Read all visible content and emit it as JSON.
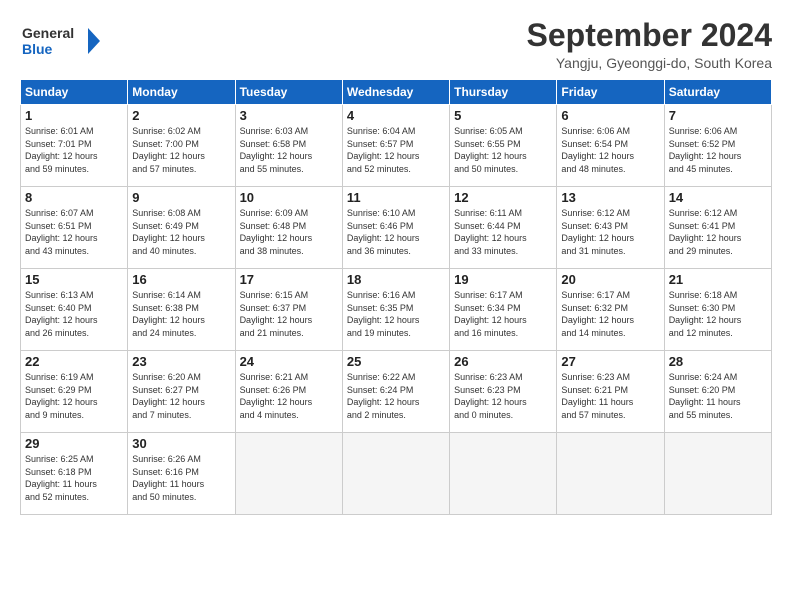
{
  "header": {
    "logo_line1": "General",
    "logo_line2": "Blue",
    "month_title": "September 2024",
    "location": "Yangju, Gyeonggi-do, South Korea"
  },
  "days_of_week": [
    "Sunday",
    "Monday",
    "Tuesday",
    "Wednesday",
    "Thursday",
    "Friday",
    "Saturday"
  ],
  "weeks": [
    [
      {
        "day": "1",
        "text": "Sunrise: 6:01 AM\nSunset: 7:01 PM\nDaylight: 12 hours\nand 59 minutes."
      },
      {
        "day": "2",
        "text": "Sunrise: 6:02 AM\nSunset: 7:00 PM\nDaylight: 12 hours\nand 57 minutes."
      },
      {
        "day": "3",
        "text": "Sunrise: 6:03 AM\nSunset: 6:58 PM\nDaylight: 12 hours\nand 55 minutes."
      },
      {
        "day": "4",
        "text": "Sunrise: 6:04 AM\nSunset: 6:57 PM\nDaylight: 12 hours\nand 52 minutes."
      },
      {
        "day": "5",
        "text": "Sunrise: 6:05 AM\nSunset: 6:55 PM\nDaylight: 12 hours\nand 50 minutes."
      },
      {
        "day": "6",
        "text": "Sunrise: 6:06 AM\nSunset: 6:54 PM\nDaylight: 12 hours\nand 48 minutes."
      },
      {
        "day": "7",
        "text": "Sunrise: 6:06 AM\nSunset: 6:52 PM\nDaylight: 12 hours\nand 45 minutes."
      }
    ],
    [
      {
        "day": "8",
        "text": "Sunrise: 6:07 AM\nSunset: 6:51 PM\nDaylight: 12 hours\nand 43 minutes."
      },
      {
        "day": "9",
        "text": "Sunrise: 6:08 AM\nSunset: 6:49 PM\nDaylight: 12 hours\nand 40 minutes."
      },
      {
        "day": "10",
        "text": "Sunrise: 6:09 AM\nSunset: 6:48 PM\nDaylight: 12 hours\nand 38 minutes."
      },
      {
        "day": "11",
        "text": "Sunrise: 6:10 AM\nSunset: 6:46 PM\nDaylight: 12 hours\nand 36 minutes."
      },
      {
        "day": "12",
        "text": "Sunrise: 6:11 AM\nSunset: 6:44 PM\nDaylight: 12 hours\nand 33 minutes."
      },
      {
        "day": "13",
        "text": "Sunrise: 6:12 AM\nSunset: 6:43 PM\nDaylight: 12 hours\nand 31 minutes."
      },
      {
        "day": "14",
        "text": "Sunrise: 6:12 AM\nSunset: 6:41 PM\nDaylight: 12 hours\nand 29 minutes."
      }
    ],
    [
      {
        "day": "15",
        "text": "Sunrise: 6:13 AM\nSunset: 6:40 PM\nDaylight: 12 hours\nand 26 minutes."
      },
      {
        "day": "16",
        "text": "Sunrise: 6:14 AM\nSunset: 6:38 PM\nDaylight: 12 hours\nand 24 minutes."
      },
      {
        "day": "17",
        "text": "Sunrise: 6:15 AM\nSunset: 6:37 PM\nDaylight: 12 hours\nand 21 minutes."
      },
      {
        "day": "18",
        "text": "Sunrise: 6:16 AM\nSunset: 6:35 PM\nDaylight: 12 hours\nand 19 minutes."
      },
      {
        "day": "19",
        "text": "Sunrise: 6:17 AM\nSunset: 6:34 PM\nDaylight: 12 hours\nand 16 minutes."
      },
      {
        "day": "20",
        "text": "Sunrise: 6:17 AM\nSunset: 6:32 PM\nDaylight: 12 hours\nand 14 minutes."
      },
      {
        "day": "21",
        "text": "Sunrise: 6:18 AM\nSunset: 6:30 PM\nDaylight: 12 hours\nand 12 minutes."
      }
    ],
    [
      {
        "day": "22",
        "text": "Sunrise: 6:19 AM\nSunset: 6:29 PM\nDaylight: 12 hours\nand 9 minutes."
      },
      {
        "day": "23",
        "text": "Sunrise: 6:20 AM\nSunset: 6:27 PM\nDaylight: 12 hours\nand 7 minutes."
      },
      {
        "day": "24",
        "text": "Sunrise: 6:21 AM\nSunset: 6:26 PM\nDaylight: 12 hours\nand 4 minutes."
      },
      {
        "day": "25",
        "text": "Sunrise: 6:22 AM\nSunset: 6:24 PM\nDaylight: 12 hours\nand 2 minutes."
      },
      {
        "day": "26",
        "text": "Sunrise: 6:23 AM\nSunset: 6:23 PM\nDaylight: 12 hours\nand 0 minutes."
      },
      {
        "day": "27",
        "text": "Sunrise: 6:23 AM\nSunset: 6:21 PM\nDaylight: 11 hours\nand 57 minutes."
      },
      {
        "day": "28",
        "text": "Sunrise: 6:24 AM\nSunset: 6:20 PM\nDaylight: 11 hours\nand 55 minutes."
      }
    ],
    [
      {
        "day": "29",
        "text": "Sunrise: 6:25 AM\nSunset: 6:18 PM\nDaylight: 11 hours\nand 52 minutes."
      },
      {
        "day": "30",
        "text": "Sunrise: 6:26 AM\nSunset: 6:16 PM\nDaylight: 11 hours\nand 50 minutes."
      },
      {
        "day": "",
        "text": ""
      },
      {
        "day": "",
        "text": ""
      },
      {
        "day": "",
        "text": ""
      },
      {
        "day": "",
        "text": ""
      },
      {
        "day": "",
        "text": ""
      }
    ]
  ]
}
